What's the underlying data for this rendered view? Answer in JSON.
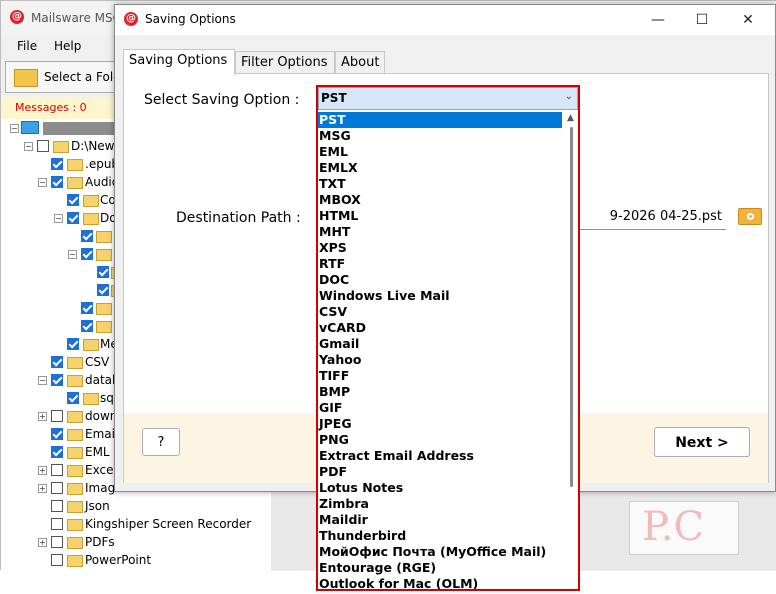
{
  "main_window": {
    "title": "Mailsware MSG",
    "menu": [
      "File",
      "Help"
    ],
    "toolbar_button": "Select a Folde",
    "messages_label": "Messages : 0",
    "tree": [
      {
        "label": "D:\\New",
        "checked": false
      },
      {
        "label": ".epub",
        "checked": true
      },
      {
        "label": "Audio",
        "checked": true
      },
      {
        "label": "Co",
        "checked": true
      },
      {
        "label": "Do",
        "checked": true
      },
      {
        "label": "",
        "checked": true
      },
      {
        "label": "",
        "checked": true
      },
      {
        "label": "",
        "checked": true
      },
      {
        "label": "",
        "checked": true
      },
      {
        "label": "",
        "checked": true
      },
      {
        "label": "",
        "checked": true
      },
      {
        "label": "Me",
        "checked": true
      },
      {
        "label": "CSV",
        "checked": true
      },
      {
        "label": "datab",
        "checked": true
      },
      {
        "label": "sq",
        "checked": true
      },
      {
        "label": "down",
        "checked": false
      },
      {
        "label": "Emai",
        "checked": true
      },
      {
        "label": "EML",
        "checked": true
      },
      {
        "label": "Exce",
        "checked": false
      },
      {
        "label": "Imag",
        "checked": false
      },
      {
        "label": "Json",
        "checked": false
      },
      {
        "label": "Kingshiper Screen Recorder",
        "checked": false
      },
      {
        "label": "PDFs",
        "checked": false
      },
      {
        "label": "PowerPoint",
        "checked": false
      }
    ]
  },
  "dialog": {
    "title": "Saving Options",
    "controls": {
      "minimize": "—",
      "maximize": "☐",
      "close": "✕"
    },
    "tabs": [
      "Saving Options",
      "Filter Options",
      "About"
    ],
    "active_tab": "Saving Options",
    "select_label": "Select Saving Option :",
    "selected_value": "PST",
    "destination_label": "Destination Path :",
    "destination_value": "9-2026 04-25.pst",
    "help_button": "?",
    "next_button": "Next >",
    "options": [
      "PST",
      "MSG",
      "EML",
      "EMLX",
      "TXT",
      "MBOX",
      "HTML",
      "MHT",
      "XPS",
      "RTF",
      "DOC",
      "Windows Live Mail",
      "CSV",
      "vCARD",
      "Gmail",
      "Yahoo",
      "TIFF",
      "BMP",
      "GIF",
      "JPEG",
      "PNG",
      "Extract Email Address",
      "PDF",
      "Lotus Notes",
      "Zimbra",
      "Maildir",
      "Thunderbird",
      "МойОфис Почта (MyOffice Mail)",
      "Entourage (RGE)",
      "Outlook for Mac (OLM)"
    ]
  },
  "watermark": "P.C",
  "colors": {
    "highlight": "#0078d7",
    "callout": "#d40000",
    "accent_folder": "#f0b43a"
  }
}
